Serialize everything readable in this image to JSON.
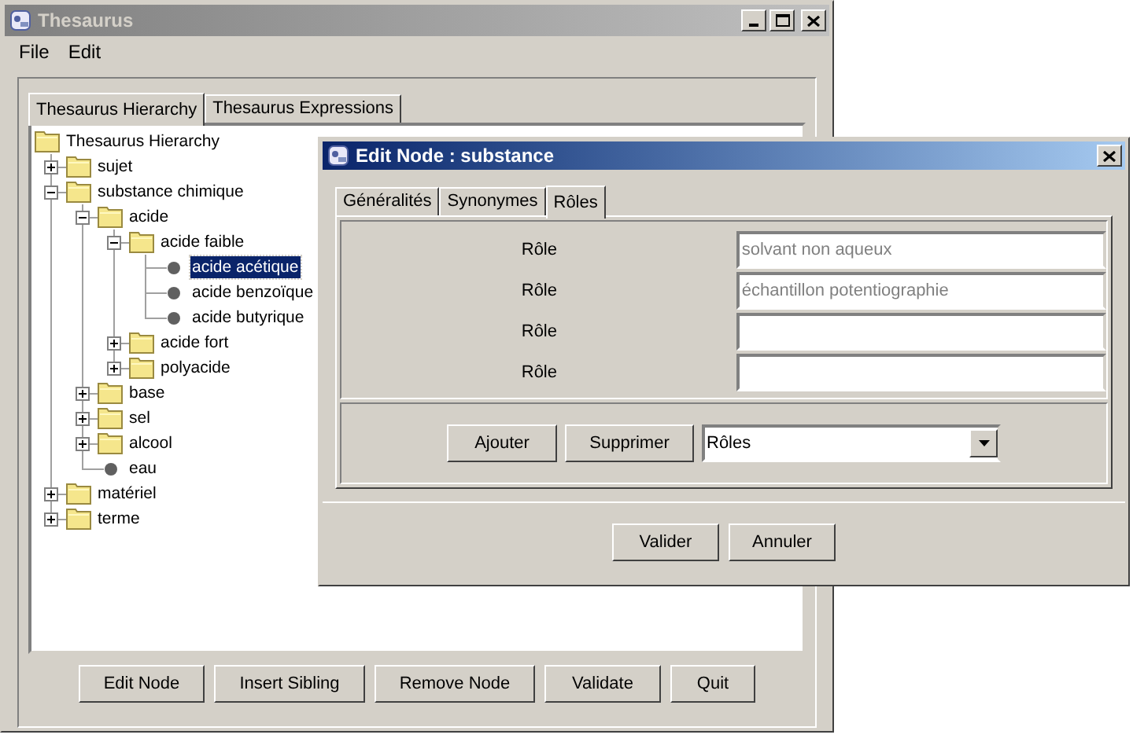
{
  "window": {
    "title": "Thesaurus"
  },
  "menu": [
    "File",
    "Edit"
  ],
  "tabs": [
    {
      "label": "Thesaurus Hierarchy",
      "selected": true
    },
    {
      "label": "Thesaurus Expressions",
      "selected": false
    }
  ],
  "tree": {
    "label": "Thesaurus Hierarchy",
    "kind": "root",
    "selected": false,
    "children": [
      {
        "label": "sujet",
        "kind": "folder",
        "expanded": false,
        "selected": false
      },
      {
        "label": "substance chimique",
        "kind": "folder",
        "expanded": true,
        "selected": false,
        "children": [
          {
            "label": "acide",
            "kind": "folder",
            "expanded": true,
            "selected": false,
            "children": [
              {
                "label": "acide faible",
                "kind": "folder",
                "expanded": true,
                "selected": false,
                "children": [
                  {
                    "label": "acide acétique",
                    "kind": "leaf",
                    "selected": true
                  },
                  {
                    "label": "acide benzoïque",
                    "kind": "leaf",
                    "selected": false
                  },
                  {
                    "label": "acide butyrique",
                    "kind": "leaf",
                    "selected": false
                  }
                ]
              },
              {
                "label": "acide fort",
                "kind": "folder",
                "expanded": false,
                "selected": false
              },
              {
                "label": "polyacide",
                "kind": "folder",
                "expanded": false,
                "selected": false
              }
            ]
          },
          {
            "label": "base",
            "kind": "folder",
            "expanded": false,
            "selected": false
          },
          {
            "label": "sel",
            "kind": "folder",
            "expanded": false,
            "selected": false
          },
          {
            "label": "alcool",
            "kind": "folder",
            "expanded": false,
            "selected": false
          },
          {
            "label": "eau",
            "kind": "leaf",
            "selected": false
          }
        ]
      },
      {
        "label": "matériel",
        "kind": "folder",
        "expanded": false,
        "selected": false
      },
      {
        "label": "terme",
        "kind": "folder",
        "expanded": false,
        "selected": false
      }
    ]
  },
  "buttons": [
    "Edit Node",
    "Insert Sibling",
    "Remove Node",
    "Validate",
    "Quit"
  ],
  "dialog": {
    "title": "Edit Node : substance",
    "tabs": [
      {
        "label": "Généralités",
        "selected": false
      },
      {
        "label": "Synonymes",
        "selected": false
      },
      {
        "label": "Rôles",
        "selected": true
      }
    ],
    "roles": [
      {
        "label": "Rôle",
        "value": "solvant non aqueux"
      },
      {
        "label": "Rôle",
        "value": "échantillon potentiographie"
      },
      {
        "label": "Rôle"
      },
      {
        "label": "Rôle"
      }
    ],
    "actions": [
      "Ajouter",
      "Supprimer"
    ],
    "dropdown": {
      "value": "Rôles"
    },
    "buttons": [
      "Valider",
      "Annuler"
    ]
  }
}
